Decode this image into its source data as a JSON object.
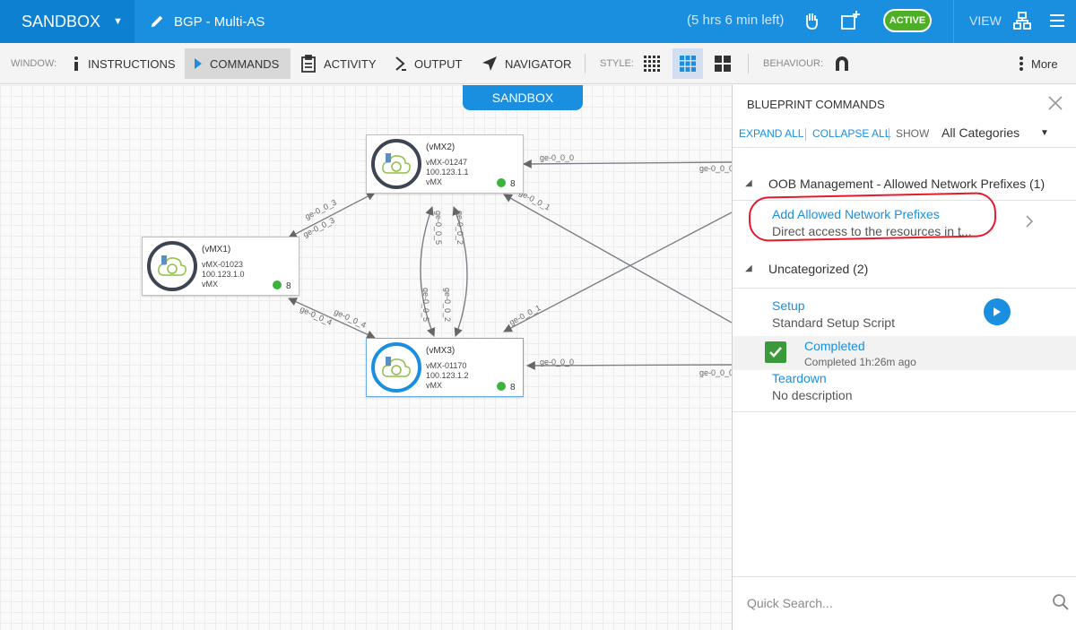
{
  "topbar": {
    "sandbox_label": "SANDBOX",
    "blueprint_name": "BGP - Multi-AS",
    "time_left": "(5 hrs 6 min left)",
    "status": "ACTIVE",
    "view_label": "VIEW"
  },
  "toolbar": {
    "window_label": "WINDOW:",
    "instructions": "INSTRUCTIONS",
    "commands": "COMMANDS",
    "activity": "ACTIVITY",
    "output": "OUTPUT",
    "navigator": "NAVIGATOR",
    "style_label": "STYLE:",
    "behaviour_label": "BEHAVIOUR:",
    "more": "More"
  },
  "canvas": {
    "sandbox_tab": "SANDBOX",
    "nodes": [
      {
        "title": "(vMX2)",
        "name": "vMX-01247",
        "ip": "100.123.1.1",
        "model": "vMX",
        "count": "8"
      },
      {
        "title": "(vMX1)",
        "name": "vMX-01023",
        "ip": "100.123.1.0",
        "model": "vMX",
        "count": "8"
      },
      {
        "title": "(vMX3)",
        "name": "vMX-01170",
        "ip": "100.123.1.2",
        "model": "vMX",
        "count": "8"
      }
    ],
    "links": {
      "l1": "ge-0_0_3",
      "l2": "ge-0_0_3",
      "l3": "ge-0_0_4",
      "l4": "ge-0_0_4",
      "l5": "ge-0_0_5",
      "l6": "ge-0_0_5",
      "l7": "ge-0_0_2",
      "l8": "ge-0_0_2",
      "l9": "ge-0_0_0",
      "l10": "ge-0_0_0",
      "l11": "ge-0_0_1",
      "l12": "ge-0_0_1",
      "l13": "ge-0_0_0",
      "l14": "ge-0_0_0"
    }
  },
  "panel": {
    "title": "BLUEPRINT COMMANDS",
    "expand_all": "EXPAND ALL",
    "collapse_all": "COLLAPSE ALL",
    "show_label": "SHOW",
    "category": "All Categories",
    "group1": "OOB Management - Allowed Network Prefixes (1)",
    "cmd1_name": "Add Allowed Network Prefixes",
    "cmd1_desc": "Direct access to the resources in t...",
    "group2": "Uncategorized (2)",
    "cmd2_name": "Setup",
    "cmd2_desc": "Standard Setup Script",
    "cmd2_status": "Completed",
    "cmd2_status_detail": "Completed 1h:26m ago",
    "cmd3_name": "Teardown",
    "cmd3_desc": "No description",
    "search_placeholder": "Quick Search..."
  }
}
